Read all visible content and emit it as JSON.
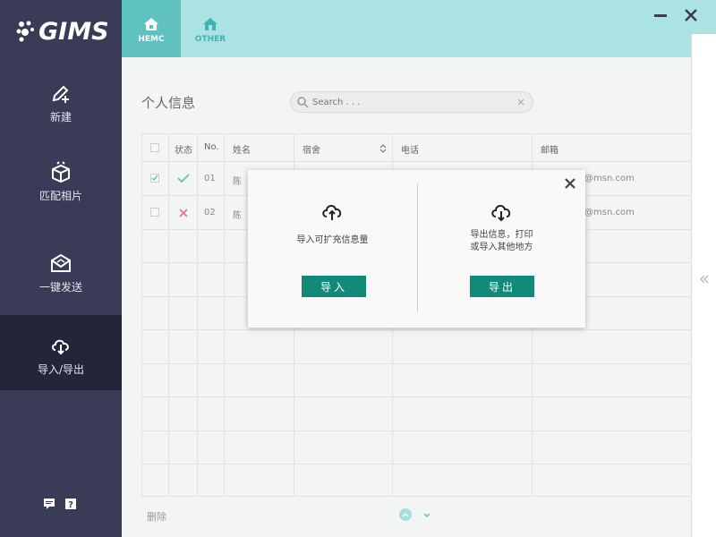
{
  "app": {
    "logo_text": "GIMS"
  },
  "sidebar": {
    "items": [
      {
        "label": "新建",
        "icon": "pen-plus-icon"
      },
      {
        "label": "匹配相片",
        "icon": "box-icon"
      },
      {
        "label": "一键发送",
        "icon": "mail-icon"
      },
      {
        "label": "导入/导出",
        "icon": "cloud-download-icon",
        "active": true
      }
    ],
    "bottom_icons": [
      "comment-icon",
      "help-icon"
    ]
  },
  "header": {
    "tabs": [
      {
        "label": "HEMC",
        "icon": "home-icon",
        "active": true
      },
      {
        "label": "OTHER",
        "icon": "home-icon"
      }
    ],
    "controls": [
      "minimize-icon",
      "close-icon"
    ]
  },
  "main": {
    "title": "个人信息",
    "search": {
      "placeholder": "Search . . .",
      "value": ""
    },
    "table": {
      "headers": [
        "状态",
        "No.",
        "姓名",
        "宿舍",
        "电话",
        "邮箱"
      ],
      "rows": [
        {
          "checked": true,
          "status": "ok",
          "no": "01",
          "name": "陈",
          "email": "@msn.com"
        },
        {
          "checked": false,
          "status": "error",
          "no": "02",
          "name": "陈",
          "email": "@msn.com"
        }
      ]
    },
    "footer": {
      "delete_label": "删除"
    }
  },
  "modal": {
    "import": {
      "text": "导入可扩充信息量",
      "button": "导入"
    },
    "export": {
      "text_line1": "导出信息，打印",
      "text_line2": "或导入其他地方",
      "button": "导出"
    }
  },
  "colors": {
    "sidebar_bg": "#3a3b56",
    "sidebar_active": "#24253b",
    "header_bg": "#abe3e2",
    "tab_active": "#5fc2bf",
    "button_green": "#128a79",
    "check_green": "#5fc2bf",
    "cross_red": "#e57a8a"
  }
}
